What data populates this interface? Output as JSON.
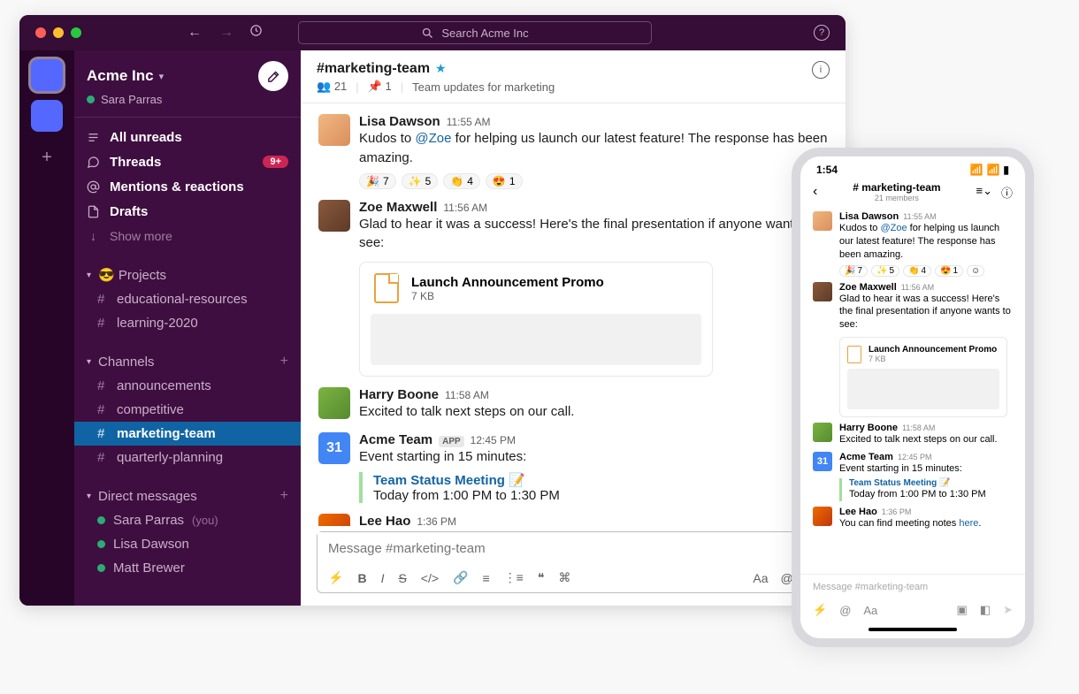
{
  "search": {
    "placeholder": "Search Acme Inc"
  },
  "workspace": {
    "name": "Acme Inc",
    "user": "Sara Parras"
  },
  "nav": {
    "all_unreads": "All unreads",
    "threads": "Threads",
    "threads_badge": "9+",
    "mentions": "Mentions & reactions",
    "drafts": "Drafts",
    "show_more": "Show more"
  },
  "sections": {
    "projects": {
      "title": "😎 Projects",
      "items": [
        "educational-resources",
        "learning-2020"
      ]
    },
    "channels": {
      "title": "Channels",
      "items": [
        "announcements",
        "competitive",
        "marketing-team",
        "quarterly-planning"
      ],
      "active": "marketing-team"
    },
    "dms": {
      "title": "Direct messages",
      "items": [
        {
          "name": "Sara Parras",
          "you": true
        },
        {
          "name": "Lisa Dawson",
          "you": false
        },
        {
          "name": "Matt Brewer",
          "you": false
        }
      ]
    }
  },
  "channel": {
    "name": "#marketing-team",
    "members": "21",
    "pinned": "1",
    "topic": "Team updates for marketing"
  },
  "messages": [
    {
      "author": "Lisa Dawson",
      "time": "11:55 AM",
      "text_pre": "Kudos to ",
      "mention": "@Zoe",
      "text_post": " for helping us launch our latest feature! The response has been amazing.",
      "reactions": [
        {
          "e": "🎉",
          "c": "7"
        },
        {
          "e": "✨",
          "c": "5"
        },
        {
          "e": "👏",
          "c": "4"
        },
        {
          "e": "😍",
          "c": "1"
        }
      ]
    },
    {
      "author": "Zoe Maxwell",
      "time": "11:56 AM",
      "text": "Glad to hear it was a success! Here's the final presentation if anyone wants to see:",
      "file": {
        "name": "Launch Announcement Promo",
        "size": "7 KB"
      }
    },
    {
      "author": "Harry Boone",
      "time": "11:58 AM",
      "text": "Excited to talk next steps on our call."
    },
    {
      "author": "Acme Team",
      "app": true,
      "time": "12:45 PM",
      "text": "Event starting in 15 minutes:",
      "event": {
        "title": "Team Status Meeting",
        "emoji": "📝",
        "when": "Today from 1:00 PM to 1:30 PM"
      }
    },
    {
      "author": "Lee Hao",
      "time": "1:36 PM",
      "text_pre": "You can find meeting notes ",
      "link_text": "here",
      "text_post": "."
    }
  ],
  "composer": {
    "placeholder": "Message #marketing-team"
  },
  "phone": {
    "time": "1:54",
    "channel": "# marketing-team",
    "members_label": "21 members",
    "composer_placeholder": "Message #marketing-team"
  }
}
